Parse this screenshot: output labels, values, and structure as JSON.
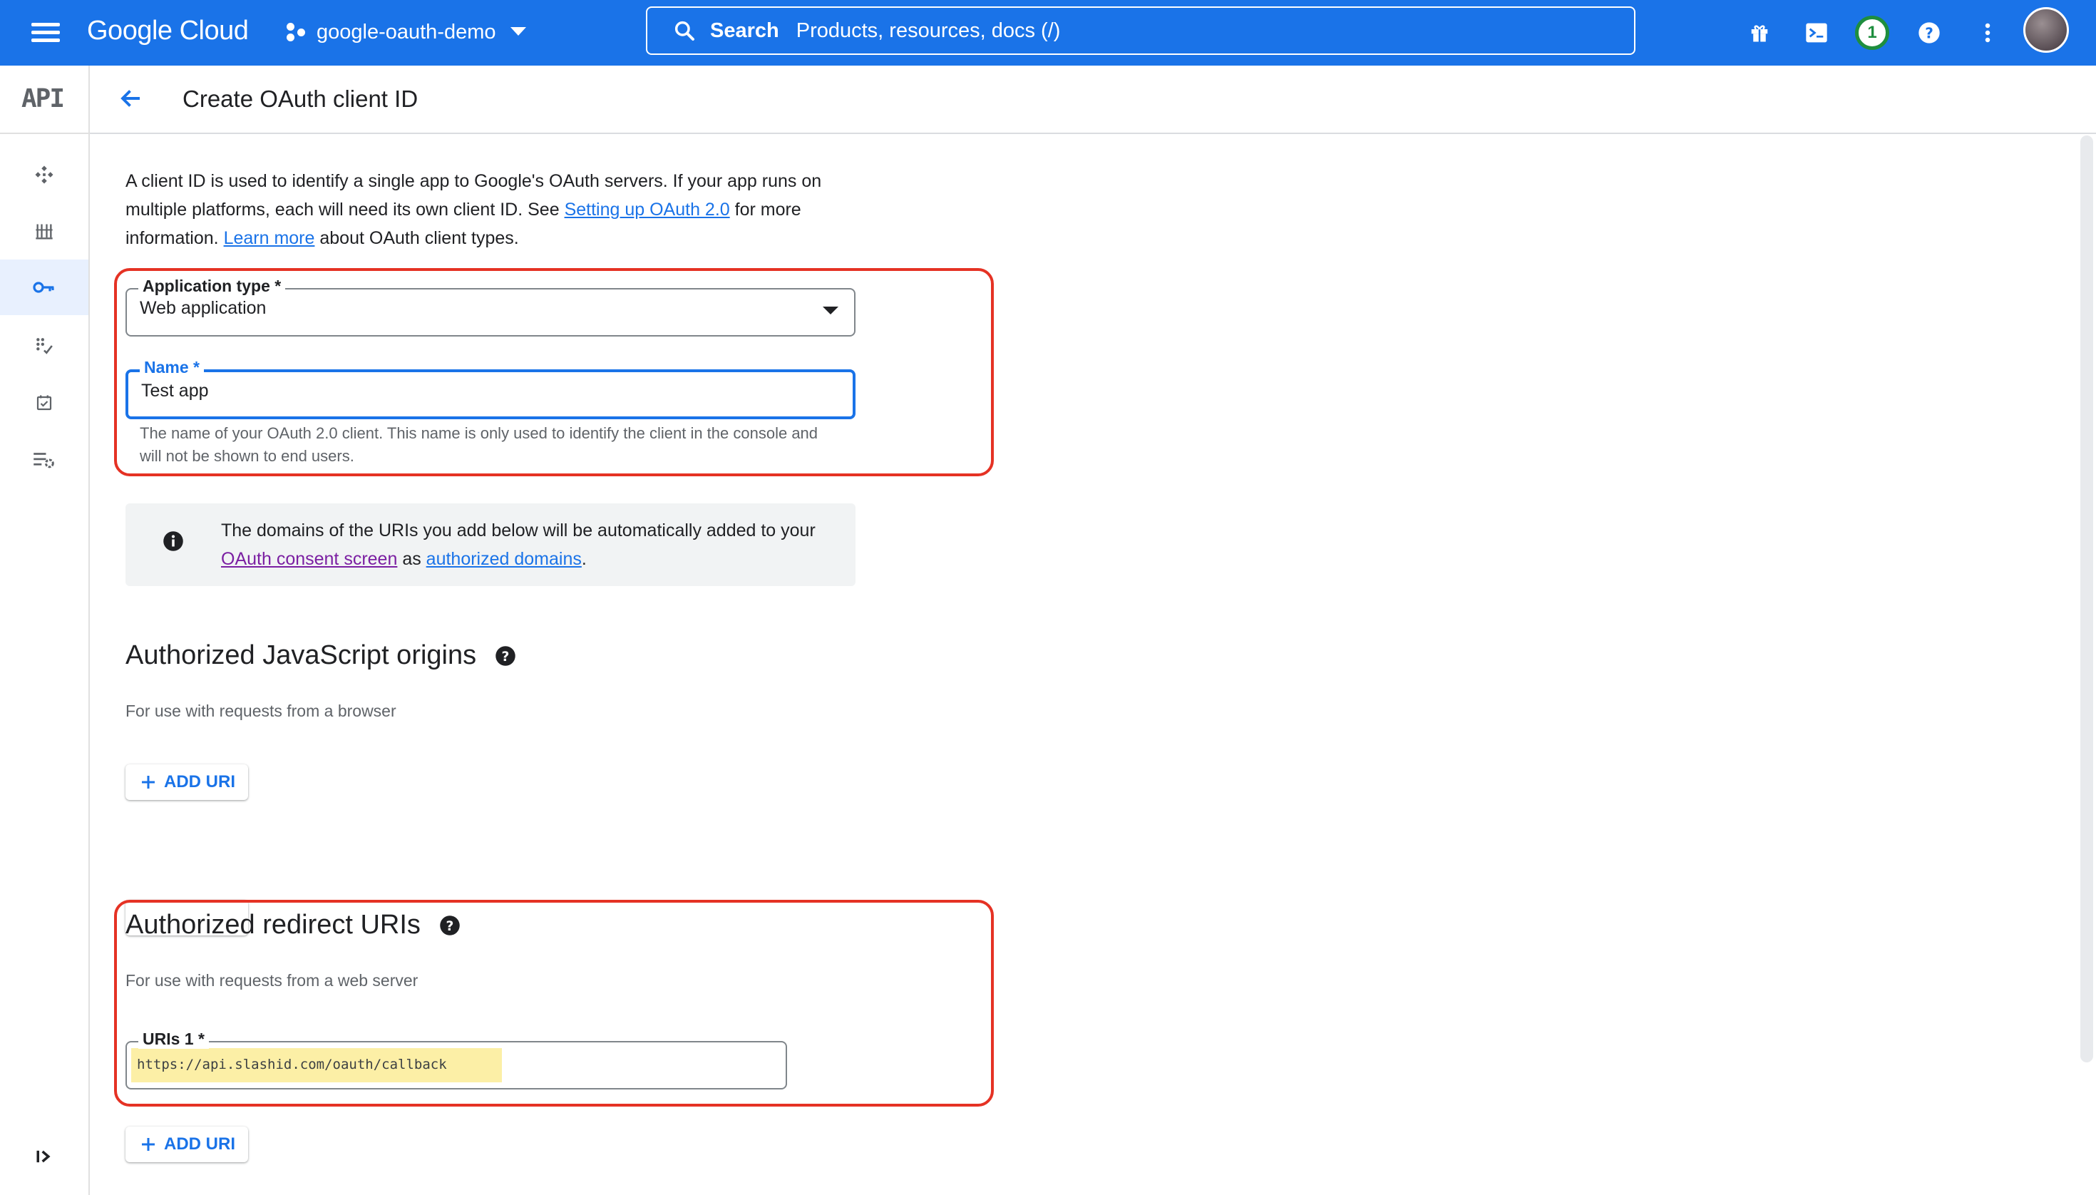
{
  "topbar": {
    "logo": "Google Cloud",
    "project": "google-oauth-demo",
    "search_label": "Search",
    "search_placeholder": "Products, resources, docs (/)",
    "notifications_count": "1"
  },
  "sidebar": {
    "product_label": "API",
    "items": [
      {
        "name": "enabled-apis",
        "icon": "apis-icon"
      },
      {
        "name": "library",
        "icon": "library-icon"
      },
      {
        "name": "credentials",
        "icon": "key-icon",
        "active": true
      },
      {
        "name": "oauth-consent",
        "icon": "consent-icon"
      },
      {
        "name": "page-usage-agreements",
        "icon": "checkbox-icon"
      },
      {
        "name": "settings",
        "icon": "list-settings-icon"
      }
    ]
  },
  "header": {
    "title": "Create OAuth client ID"
  },
  "intro": {
    "part1": "A client ID is used to identify a single app to Google's OAuth servers. If your app runs on multiple platforms, each will need its own client ID. See ",
    "link1": "Setting up OAuth 2.0",
    "part2": " for more information. ",
    "link2": "Learn more",
    "part3": " about OAuth client types."
  },
  "form": {
    "app_type_label": "Application type *",
    "app_type_value": "Web application",
    "name_label": "Name *",
    "name_value": "Test app",
    "name_hint": "The name of your OAuth 2.0 client. This name is only used to identify the client in the console and will not be shown to end users."
  },
  "info": {
    "part1": "The domains of the URIs you add below will be automatically added to your ",
    "link1": "OAuth consent screen",
    "part2": " as ",
    "link2": "authorized domains",
    "part3": "."
  },
  "js_origins": {
    "title": "Authorized JavaScript origins",
    "subtitle": "For use with requests from a browser",
    "add_label": "ADD URI"
  },
  "redirect_uris": {
    "title": "Authorized redirect URIs",
    "subtitle": "For use with requests from a web server",
    "uri_label": "URIs 1 *",
    "uri_value": "https://api.slashid.com/oauth/callback",
    "add_label": "ADD URI"
  },
  "colors": {
    "brand_blue": "#1a73e8",
    "highlight_red": "#e53224",
    "highlight_yellow": "#fcefa6"
  }
}
